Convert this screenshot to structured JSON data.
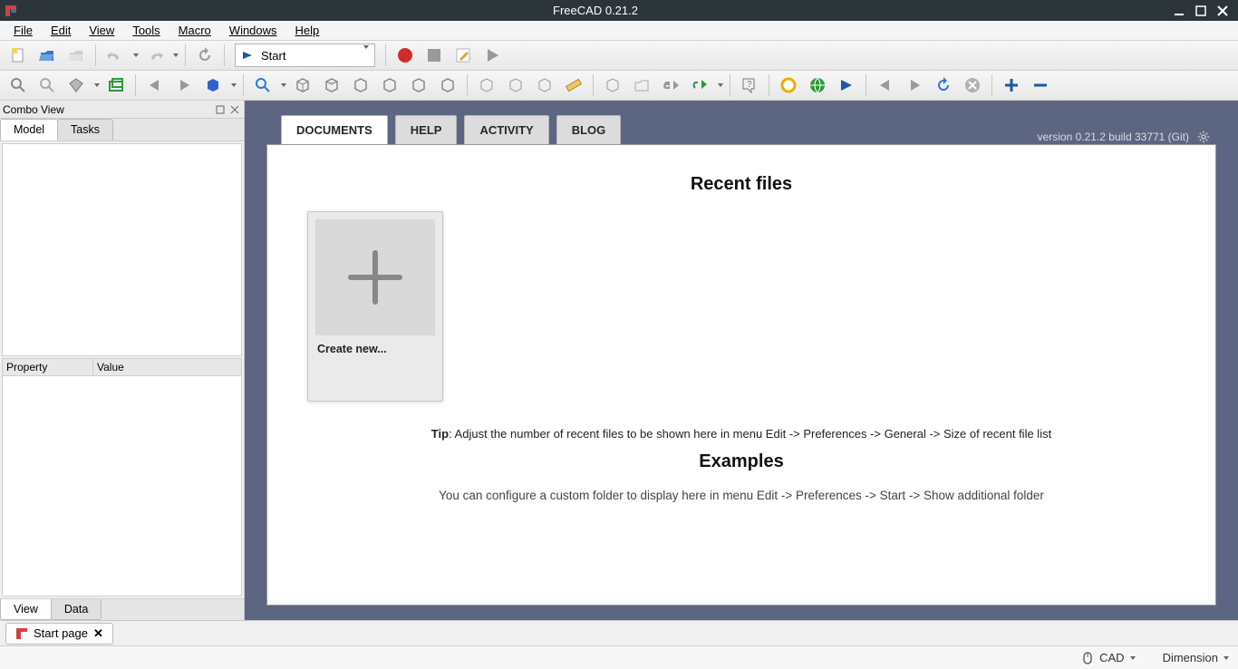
{
  "titlebar": {
    "title": "FreeCAD 0.21.2"
  },
  "menus": [
    "File",
    "Edit",
    "View",
    "Tools",
    "Macro",
    "Windows",
    "Help"
  ],
  "workbench": {
    "selected": "Start"
  },
  "combo": {
    "title": "Combo View",
    "top_tabs": [
      "Model",
      "Tasks"
    ],
    "top_active": 0,
    "prop_cols": [
      "Property",
      "Value"
    ],
    "bottom_tabs": [
      "View",
      "Data"
    ],
    "bottom_active": 0
  },
  "start": {
    "tabs": [
      "DOCUMENTS",
      "HELP",
      "ACTIVITY",
      "BLOG"
    ],
    "active": 0,
    "version": "version 0.21.2 build 33771 (Git)",
    "recent_heading": "Recent files",
    "create_new": "Create new...",
    "tip_label": "Tip",
    "tip_text": ": Adjust the number of recent files to be shown here in menu Edit -> Preferences -> General -> Size of recent file list",
    "examples_heading": "Examples",
    "cfg_text": "You can configure a custom folder to display here in menu Edit -> Preferences -> Start -> Show additional folder"
  },
  "doc_tab": {
    "label": "Start page"
  },
  "status": {
    "left": "CAD",
    "right": "Dimension"
  }
}
